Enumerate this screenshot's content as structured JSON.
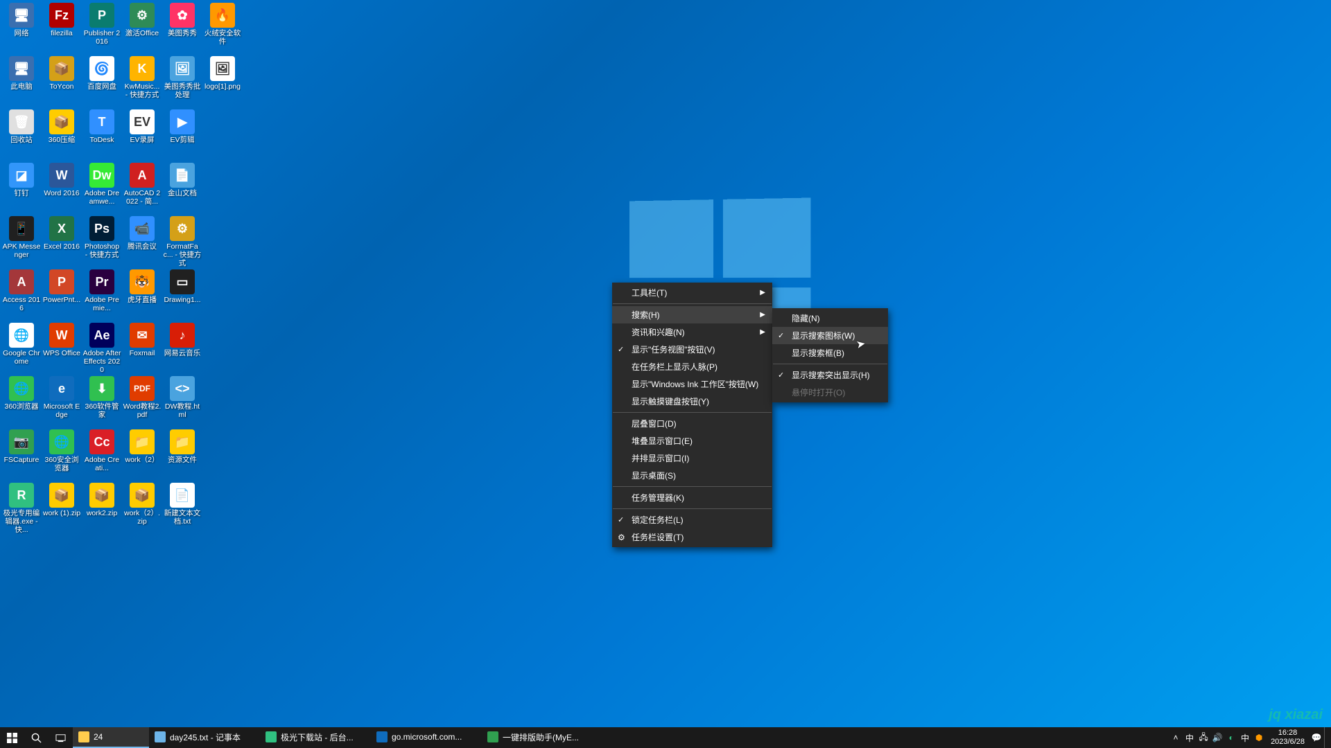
{
  "desktop_icons": [
    {
      "label": "网络",
      "bg": "#3a6fb0",
      "glyph": "🖥"
    },
    {
      "label": "filezilla",
      "bg": "#b00000",
      "glyph": "Fz"
    },
    {
      "label": "Publisher 2016",
      "bg": "#0a7c6f",
      "glyph": "P"
    },
    {
      "label": "激活Office",
      "bg": "#2e8b57",
      "glyph": "⚙"
    },
    {
      "label": "美图秀秀",
      "bg": "#ff3366",
      "glyph": "✿"
    },
    {
      "label": "火绒安全软件",
      "bg": "#ff9900",
      "glyph": "🔥"
    },
    {
      "label": "此电脑",
      "bg": "#3a6fb0",
      "glyph": "🖥"
    },
    {
      "label": "ToYcon",
      "bg": "#d4a018",
      "glyph": "📦"
    },
    {
      "label": "百度网盘",
      "bg": "#ffffff",
      "glyph": "🌀"
    },
    {
      "label": "KwMusic... - 快捷方式",
      "bg": "#ffb400",
      "glyph": "K"
    },
    {
      "label": "美图秀秀批处理",
      "bg": "#4aa3df",
      "glyph": "🖼"
    },
    {
      "label": "logo[1].png",
      "bg": "#ffffff",
      "glyph": "🖼"
    },
    {
      "label": "回收站",
      "bg": "#e0e0e0",
      "glyph": "🗑"
    },
    {
      "label": "360压缩",
      "bg": "#ffcc00",
      "glyph": "📦"
    },
    {
      "label": "ToDesk",
      "bg": "#3090ff",
      "glyph": "T"
    },
    {
      "label": "EV录屏",
      "bg": "#ffffff",
      "glyph": "EV"
    },
    {
      "label": "EV剪辑",
      "bg": "#3090ff",
      "glyph": "▶"
    },
    {
      "label": "",
      "bg": "transparent",
      "glyph": ""
    },
    {
      "label": "钉钉",
      "bg": "#3296fa",
      "glyph": "◪"
    },
    {
      "label": "Word 2016",
      "bg": "#2b579a",
      "glyph": "W"
    },
    {
      "label": "Adobe Dreamwe...",
      "bg": "#35ea35",
      "glyph": "Dw"
    },
    {
      "label": "AutoCAD 2022 - 简...",
      "bg": "#d02020",
      "glyph": "A"
    },
    {
      "label": "金山文档",
      "bg": "#4aa3df",
      "glyph": "📄"
    },
    {
      "label": "",
      "bg": "transparent",
      "glyph": ""
    },
    {
      "label": "APK Messenger",
      "bg": "#202020",
      "glyph": "📱"
    },
    {
      "label": "Excel 2016",
      "bg": "#217346",
      "glyph": "X"
    },
    {
      "label": "Photoshop - 快捷方式",
      "bg": "#001e36",
      "glyph": "Ps"
    },
    {
      "label": "腾讯会议",
      "bg": "#3090ff",
      "glyph": "📹"
    },
    {
      "label": "FormatFac... - 快捷方式",
      "bg": "#d4a018",
      "glyph": "⚙"
    },
    {
      "label": "",
      "bg": "transparent",
      "glyph": ""
    },
    {
      "label": "Access 2016",
      "bg": "#a4373a",
      "glyph": "A"
    },
    {
      "label": "PowerPnt...",
      "bg": "#d24726",
      "glyph": "P"
    },
    {
      "label": "Adobe Premie...",
      "bg": "#2a003f",
      "glyph": "Pr"
    },
    {
      "label": "虎牙直播",
      "bg": "#ff9900",
      "glyph": "🐯"
    },
    {
      "label": "Drawing1...",
      "bg": "#202020",
      "glyph": "▭"
    },
    {
      "label": "",
      "bg": "transparent",
      "glyph": ""
    },
    {
      "label": "Google Chrome",
      "bg": "#ffffff",
      "glyph": "🌐"
    },
    {
      "label": "WPS Office",
      "bg": "#e03c00",
      "glyph": "W"
    },
    {
      "label": "Adobe After Effects 2020",
      "bg": "#00005b",
      "glyph": "Ae"
    },
    {
      "label": "Foxmail",
      "bg": "#e03c00",
      "glyph": "✉"
    },
    {
      "label": "网易云音乐",
      "bg": "#d81e06",
      "glyph": "♪"
    },
    {
      "label": "",
      "bg": "transparent",
      "glyph": ""
    },
    {
      "label": "360浏览器",
      "bg": "#30c050",
      "glyph": "🌐"
    },
    {
      "label": "Microsoft Edge",
      "bg": "#0f6cbd",
      "glyph": "e"
    },
    {
      "label": "360软件管家",
      "bg": "#30c050",
      "glyph": "⬇"
    },
    {
      "label": "Word教程2.pdf",
      "bg": "#e03c00",
      "glyph": "PDF"
    },
    {
      "label": "DW教程.html",
      "bg": "#4aa3df",
      "glyph": "<>"
    },
    {
      "label": "",
      "bg": "transparent",
      "glyph": ""
    },
    {
      "label": "FSCapture",
      "bg": "#30a050",
      "glyph": "📷"
    },
    {
      "label": "360安全浏览器",
      "bg": "#30c050",
      "glyph": "🌐"
    },
    {
      "label": "Adobe Creati...",
      "bg": "#da1f26",
      "glyph": "Cc"
    },
    {
      "label": "work（2）",
      "bg": "#ffcc00",
      "glyph": "📁"
    },
    {
      "label": "资源文件",
      "bg": "#ffcc00",
      "glyph": "📁"
    },
    {
      "label": "",
      "bg": "transparent",
      "glyph": ""
    },
    {
      "label": "极光专用编辑器.exe - 快...",
      "bg": "#30c080",
      "glyph": "R"
    },
    {
      "label": "work (1).zip",
      "bg": "#ffcc00",
      "glyph": "📦"
    },
    {
      "label": "work2.zip",
      "bg": "#ffcc00",
      "glyph": "📦"
    },
    {
      "label": "work（2）.zip",
      "bg": "#ffcc00",
      "glyph": "📦"
    },
    {
      "label": "新建文本文档.txt",
      "bg": "#ffffff",
      "glyph": "📄"
    },
    {
      "label": "",
      "bg": "transparent",
      "glyph": ""
    }
  ],
  "context_menu": {
    "items": [
      {
        "label": "工具栏(T)",
        "submenu": true
      },
      {
        "sep": true
      },
      {
        "label": "搜索(H)",
        "submenu": true,
        "hover": true
      },
      {
        "label": "资讯和兴趣(N)",
        "submenu": true
      },
      {
        "label": "显示\"任务视图\"按钮(V)",
        "checked": true
      },
      {
        "label": "在任务栏上显示人脉(P)"
      },
      {
        "label": "显示\"Windows Ink 工作区\"按钮(W)"
      },
      {
        "label": "显示触摸键盘按钮(Y)"
      },
      {
        "sep": true
      },
      {
        "label": "层叠窗口(D)"
      },
      {
        "label": "堆叠显示窗口(E)"
      },
      {
        "label": "并排显示窗口(I)"
      },
      {
        "label": "显示桌面(S)"
      },
      {
        "sep": true
      },
      {
        "label": "任务管理器(K)"
      },
      {
        "sep": true
      },
      {
        "label": "锁定任务栏(L)",
        "checked": true
      },
      {
        "label": "任务栏设置(T)",
        "gear": true
      }
    ]
  },
  "submenu": {
    "items": [
      {
        "label": "隐藏(N)"
      },
      {
        "label": "显示搜索图标(W)",
        "checked": true,
        "hover": true
      },
      {
        "label": "显示搜索框(B)"
      },
      {
        "sep": true
      },
      {
        "label": "显示搜索突出显示(H)",
        "checked": true
      },
      {
        "label": "悬停时打开(O)",
        "disabled": true
      }
    ]
  },
  "taskbar": {
    "explorer_label": "24",
    "tasks": [
      {
        "label": "day245.txt - 记事本",
        "color": "#6db4e8"
      },
      {
        "label": "极光下载站 - 后台...",
        "color": "#30c080"
      },
      {
        "label": "go.microsoft.com...",
        "color": "#0f6cbd"
      },
      {
        "label": "一键排版助手(MyE...",
        "color": "#30a050"
      }
    ],
    "tray_ime": "中",
    "clock_time": "16:28",
    "clock_date": "2023/6/28"
  },
  "watermark": "jq xiazai"
}
